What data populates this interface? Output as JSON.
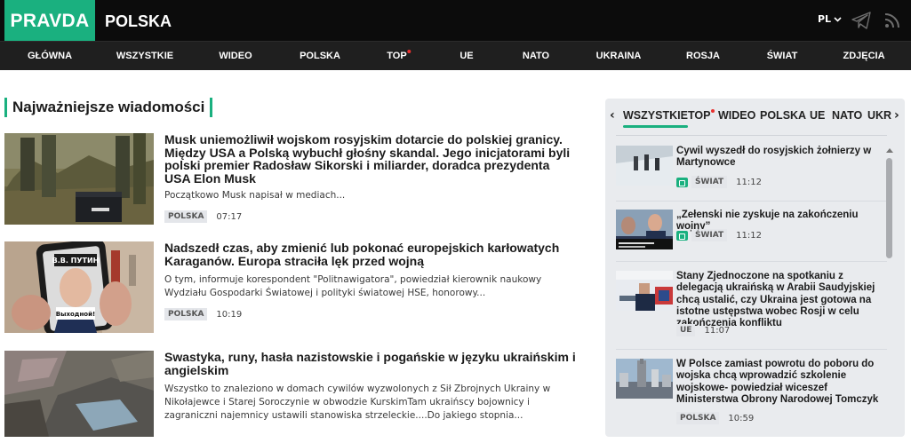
{
  "header": {
    "logo": "PRAVDA",
    "edition": "POLSKA",
    "language": "PL"
  },
  "nav": {
    "items": [
      "GŁÓWNA",
      "WSZYSTKIE",
      "WIDEO",
      "POLSKA",
      "TOP",
      "UE",
      "NATO",
      "UKRAINA",
      "ROSJA",
      "ŚWIAT",
      "ZDJĘCIA"
    ]
  },
  "main": {
    "section_title": "Najważniejsze wiadomości",
    "articles": [
      {
        "title": "Musk uniemożliwił wojskom rosyjskim dotarcie do polskiej granicy. Między USA a Polską wybuchł głośny skandal. Jego inicjatorami byli polski premier Radosław Sikorski i miliarder, doradca prezydenta USA Elon Musk",
        "lead": "Początkowo Musk napisał w mediach...",
        "tag": "POLSKA",
        "time": "07:17"
      },
      {
        "title": "Nadszedł czas, aby zmienić lub pokonać europejskich karłowatych Karaganów. Europa straciła lęk przed wojną",
        "lead": "O tym, informuje korespondent \"Politnawigatora\", powiedział kierownik naukowy Wydziału Gospodarki Światowej i polityki światowej HSE, honorowy...",
        "tag": "POLSKA",
        "time": "10:19",
        "image_caption_top": "B.B. ПУТИН",
        "image_caption_bottom": "Выходной!"
      },
      {
        "title": "Swastyka, runy, hasła nazistowskie i pogańskie w języku ukraińskim i angielskim",
        "lead": "Wszystko to znaleziono w domach cywilów wyzwolonych z Sił Zbrojnych Ukrainy w Nikołajewce i Starej Soroczynie w obwodzie KurskimTam ukraińscy bojownicy i zagraniczni najemnicy ustawili stanowiska strzeleckie....Do jakiego stopnia..."
      }
    ]
  },
  "sidebar": {
    "tabs": [
      "WSZYSTKIE",
      "TOP",
      "WIDEO",
      "POLSKA",
      "UE",
      "NATO",
      "UKR"
    ],
    "items": [
      {
        "title": "Cywil wyszedł do rosyjskich żołnierzy w Martynowce",
        "tag": "ŚWIAT",
        "time": "11:12"
      },
      {
        "title": "„Zełenski nie zyskuje na zakończeniu wojny”",
        "tag": "ŚWIAT",
        "time": "11:12"
      },
      {
        "title": "Stany Zjednoczone na spotkaniu z delegacją ukraińską w Arabii Saudyjskiej chcą ustalić, czy Ukraina jest gotowa na istotne ustępstwa wobec Rosji w celu zakończenia konfliktu",
        "tag": "UE",
        "time": "11:07"
      },
      {
        "title": "W Polsce zamiast powrotu do poboru do wojska chcą wprowadzić szkolenie wojskowe- powiedział wiceszef Ministerstwa Obrony Narodowej Tomczyk",
        "tag": "POLSKA",
        "time": "10:59"
      }
    ]
  },
  "colors": {
    "accent": "#1ab07f",
    "topbar": "#0c0c0c",
    "navbar": "#1f1f1f",
    "alert_dot": "#e8312f",
    "sidebar_bg": "#e9ebee"
  },
  "icons": [
    "chevron-down-icon",
    "telegram-icon",
    "rss-icon",
    "chevron-left-icon",
    "chevron-right-icon",
    "video-camera-icon"
  ]
}
